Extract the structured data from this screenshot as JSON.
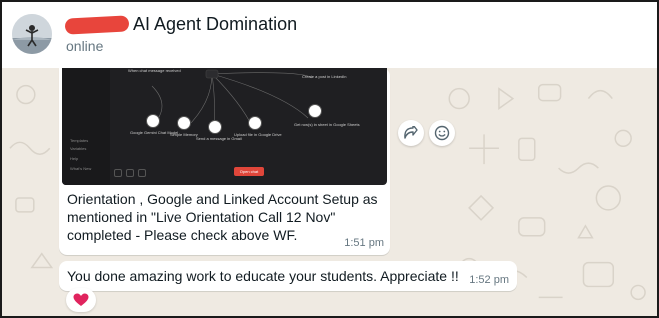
{
  "header": {
    "contact_name": "AI Agent Domination",
    "status": "online"
  },
  "messages": [
    {
      "text": "Orientation , Google and Linked Account Setup  as\nmentioned in \"Live Orientation Call 12 Nov\"\ncompleted - Please check above WF.",
      "time": "1:51 pm"
    },
    {
      "text": "You done amazing work to educate your students. Appreciate !!",
      "time": "1:52 pm"
    }
  ],
  "reaction": {
    "emoji": "❤"
  },
  "icons": {
    "forward": "forward-icon",
    "emoji": "smiley-icon"
  },
  "colors": {
    "wallpaper": "#efeae2",
    "bubble": "#ffffff",
    "redaction": "#e8453c"
  }
}
